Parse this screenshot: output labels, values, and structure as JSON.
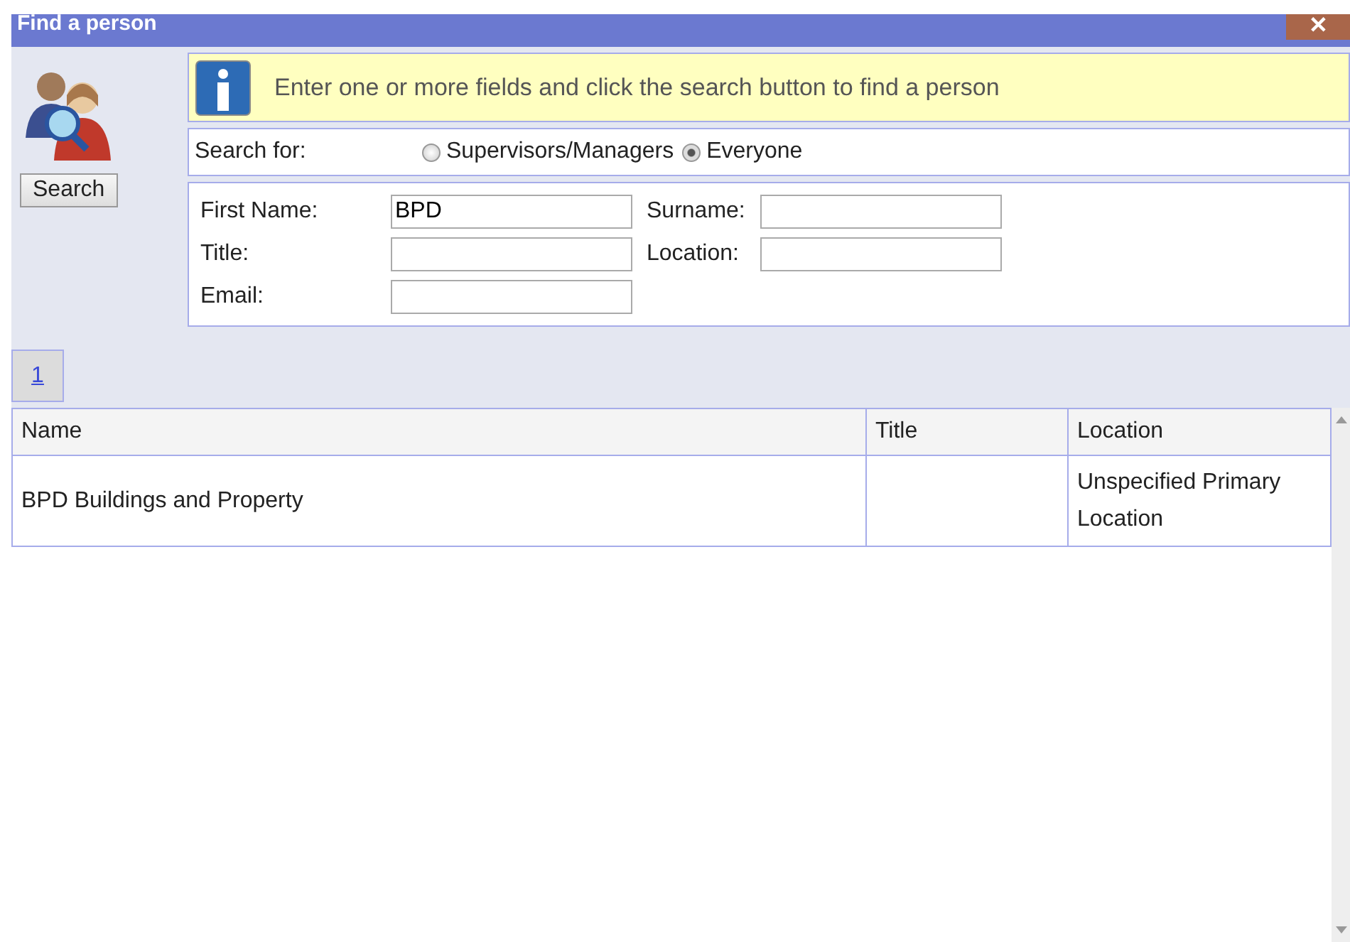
{
  "window": {
    "title": "Find a person",
    "close": "✕"
  },
  "search_button": "Search",
  "info": "Enter one or more fields and click the search button to find a person",
  "search_for": {
    "label": "Search for:",
    "options": [
      {
        "label": "Supervisors/Managers",
        "selected": false
      },
      {
        "label": "Everyone",
        "selected": true
      }
    ]
  },
  "fields": [
    {
      "label": "First Name:",
      "value": "BPD"
    },
    {
      "label": "Surname:"
    },
    {
      "label": "Title:"
    },
    {
      "label": "Location:"
    },
    {
      "label": "Email:"
    }
  ],
  "pages": [
    {
      "label": "1",
      "selected": true
    }
  ],
  "table": {
    "columns": [
      "Name",
      "Title",
      "Location"
    ],
    "rows": [
      {
        "cells": [
          "BPD Buildings and Property",
          "",
          "Unspecified Primary Location"
        ]
      }
    ]
  }
}
